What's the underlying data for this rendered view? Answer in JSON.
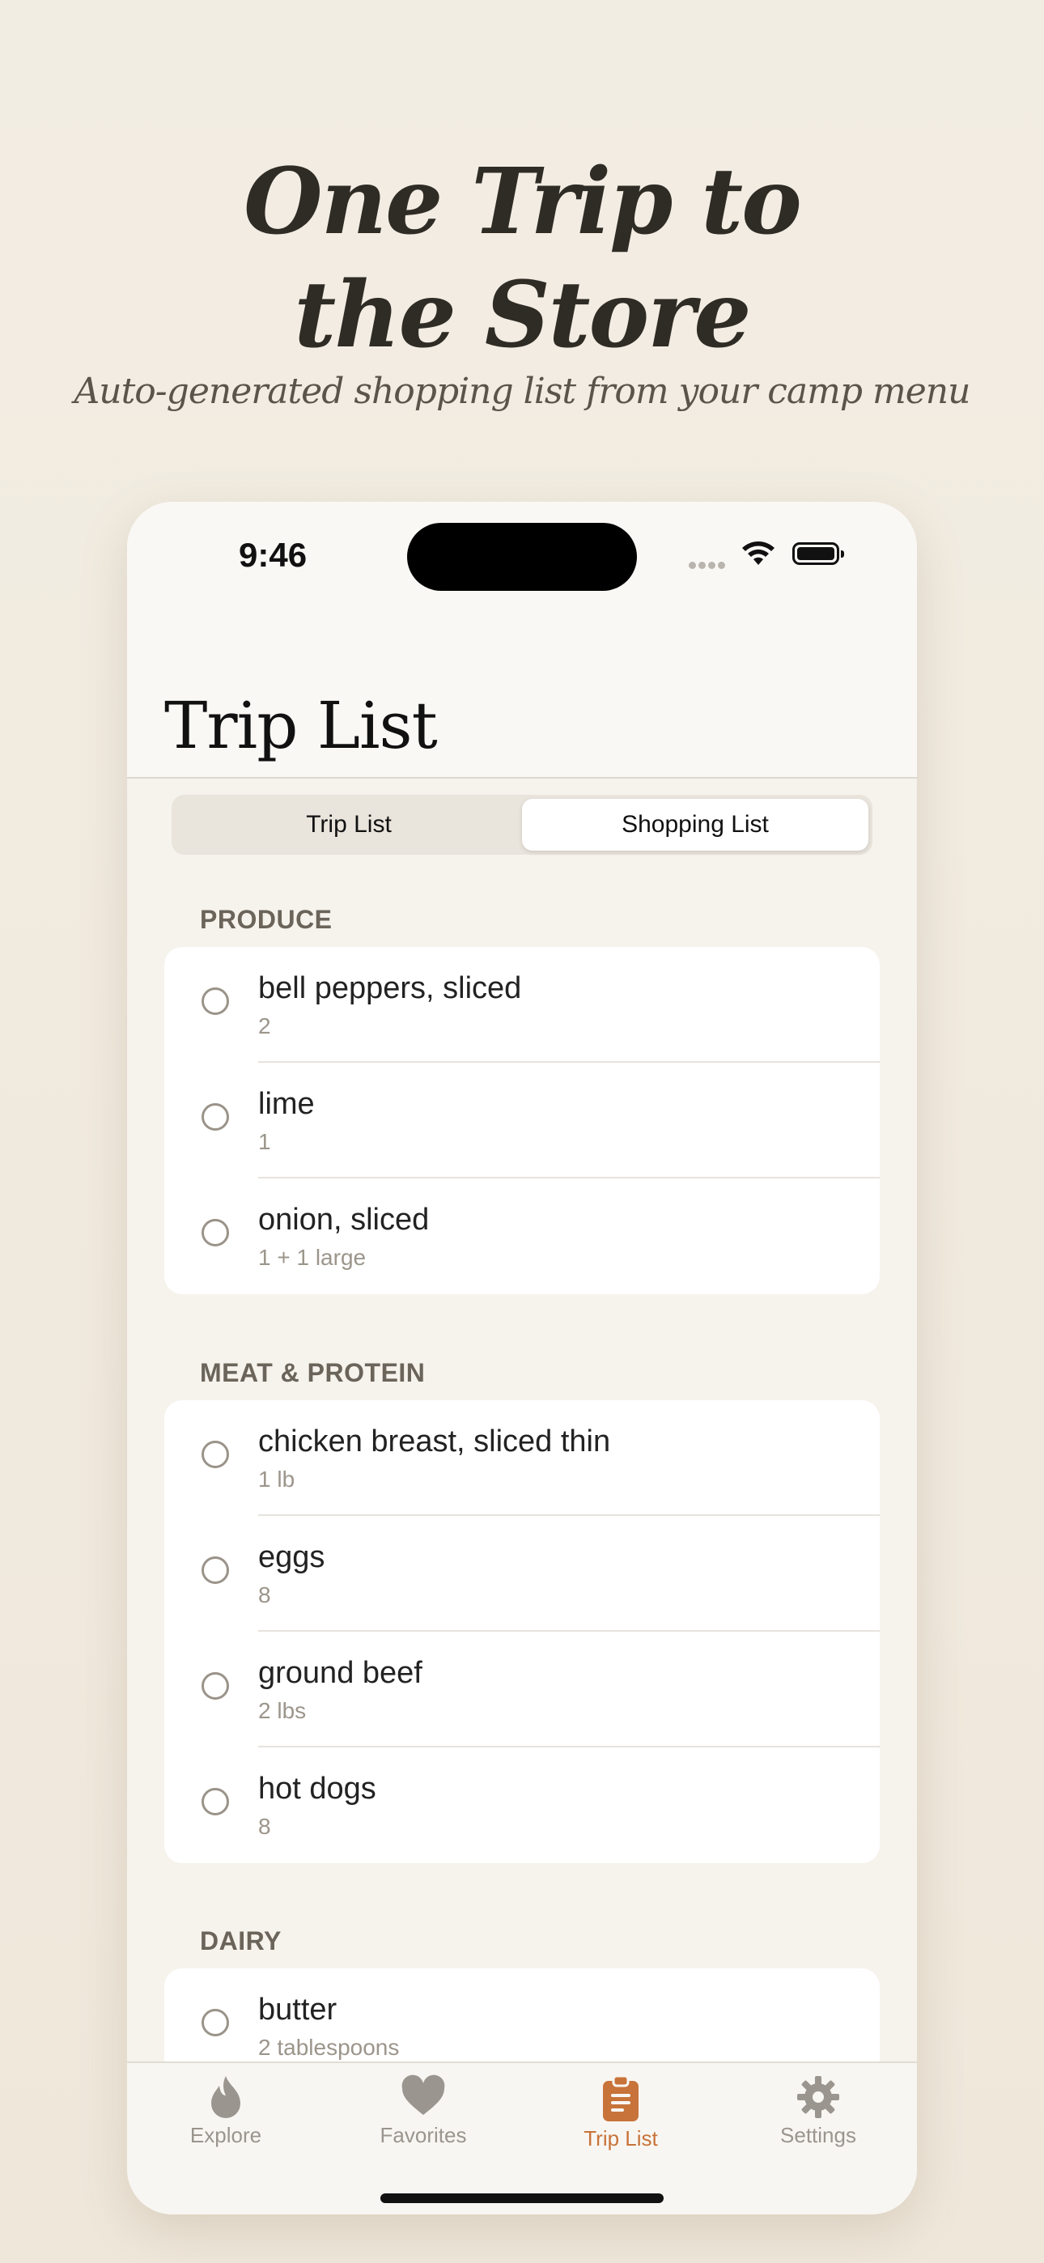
{
  "marketing": {
    "headline_line1": "One Trip to",
    "headline_line2": "the Store",
    "subheadline": "Auto-generated shopping list from your camp menu"
  },
  "status_bar": {
    "time": "9:46"
  },
  "nav": {
    "title": "Trip List"
  },
  "segmented_control": {
    "options": [
      "Trip List",
      "Shopping List"
    ],
    "selected": "Shopping List"
  },
  "sections": [
    {
      "label": "PRODUCE",
      "items": [
        {
          "name": "bell peppers, sliced",
          "qty": "2"
        },
        {
          "name": "lime",
          "qty": "1"
        },
        {
          "name": "onion, sliced",
          "qty": "1 + 1 large"
        }
      ]
    },
    {
      "label": "MEAT & PROTEIN",
      "items": [
        {
          "name": "chicken breast, sliced thin",
          "qty": "1 lb"
        },
        {
          "name": "eggs",
          "qty": "8"
        },
        {
          "name": "ground beef",
          "qty": "2 lbs"
        },
        {
          "name": "hot dogs",
          "qty": "8"
        }
      ]
    },
    {
      "label": "DAIRY",
      "items": [
        {
          "name": "butter",
          "qty": "2 tablespoons"
        }
      ]
    }
  ],
  "tabbar": {
    "tabs": [
      {
        "label": "Explore",
        "icon": "flame-icon"
      },
      {
        "label": "Favorites",
        "icon": "heart-icon"
      },
      {
        "label": "Trip List",
        "icon": "clipboard-icon"
      },
      {
        "label": "Settings",
        "icon": "gear-icon"
      }
    ],
    "active": "Trip List"
  },
  "colors": {
    "accent": "#c8733a",
    "background": "#f2ede3",
    "inactive_tab": "#9a958e"
  }
}
